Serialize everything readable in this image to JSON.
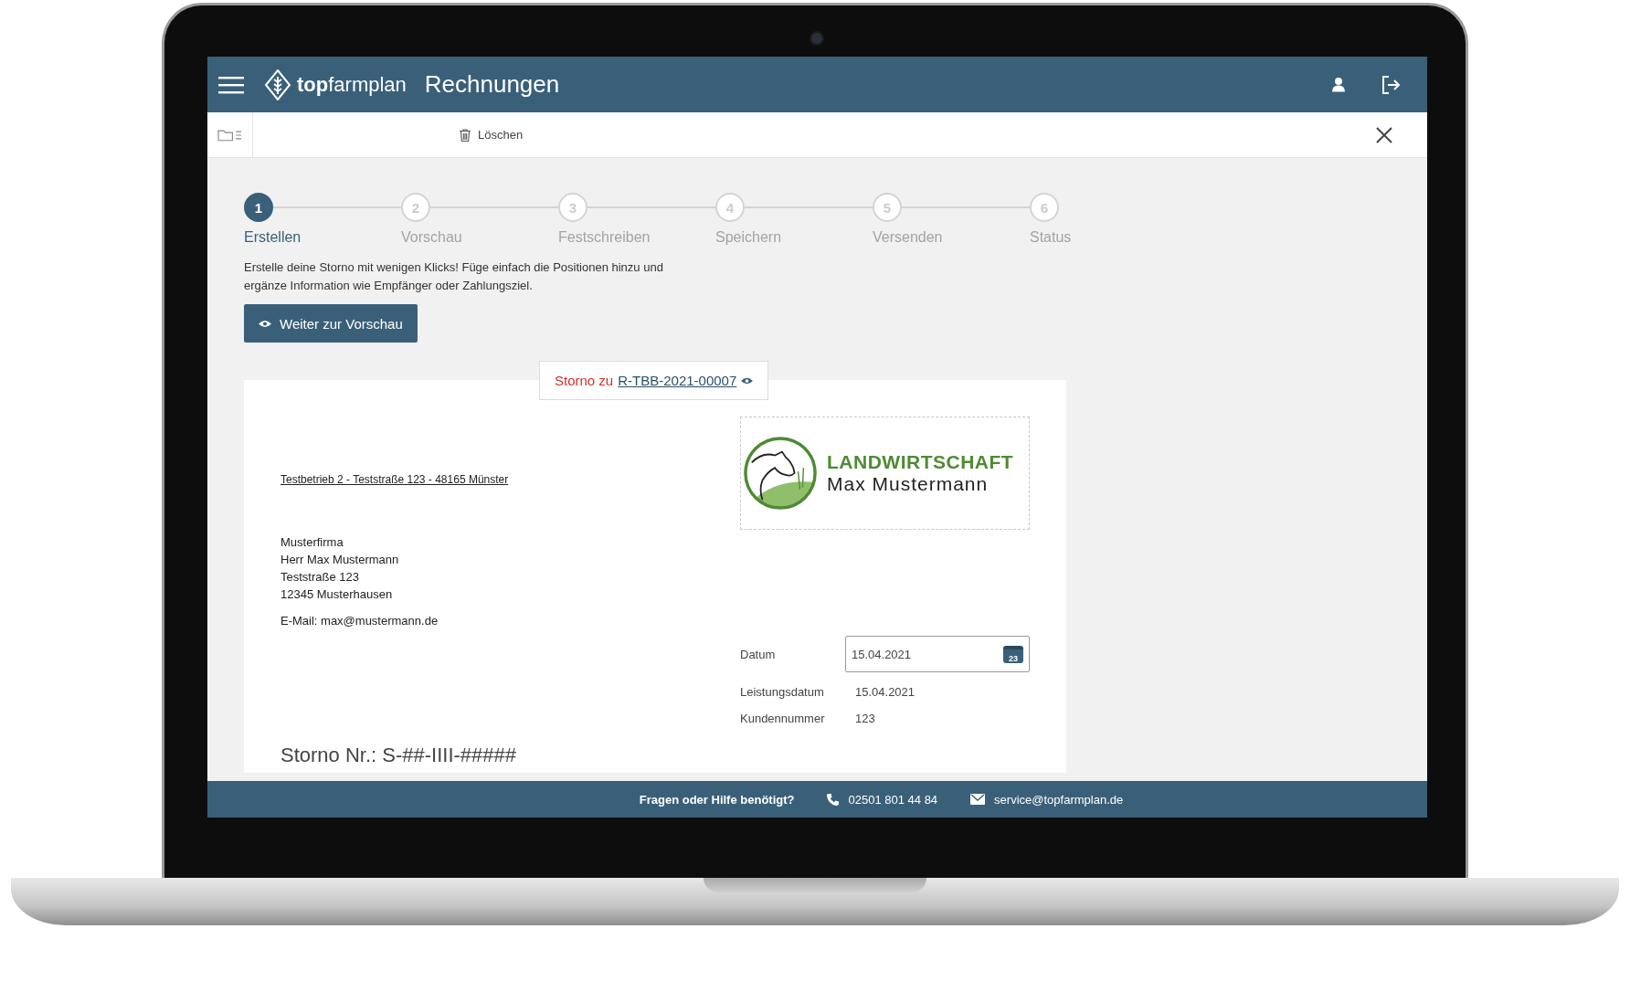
{
  "header": {
    "logo_text": "**top**farmplan",
    "title": "Rechnungen"
  },
  "toolbar": {
    "delete_label": "Löschen"
  },
  "stepper": {
    "steps": [
      {
        "number": "1",
        "label": "Erstellen",
        "selected": true
      },
      {
        "number": "2",
        "label": "Vorschau",
        "selected": false
      },
      {
        "number": "3",
        "label": "Festschreiben",
        "selected": false
      },
      {
        "number": "4",
        "label": "Speichern",
        "selected": false
      },
      {
        "number": "5",
        "label": "Versenden",
        "selected": false
      },
      {
        "number": "6",
        "label": "Status",
        "selected": false
      }
    ]
  },
  "intro": "Erstelle deine Storno mit wenigen Klicks! Füge einfach die Positionen hinzu und ergänze Information wie Empfänger oder Zahlungsziel.",
  "primary_button": "Weiter zur Vorschau",
  "document": {
    "tab": {
      "prefix": "Storno zu",
      "link": "R-TBB-2021-00007"
    },
    "sender_line": "Testbetrieb 2 - Teststraße 123 - 48165 Münster",
    "recipient_lines": [
      "Musterfirma",
      "Herr Max Mustermann",
      "Teststraße 123",
      "12345 Musterhausen"
    ],
    "email": "E-Mail: max@mustermann.de",
    "logo": {
      "line_1": "LANDWIRTSCHAFT",
      "line_2": "Max Mustermann"
    },
    "date_field": {
      "label": "Datum",
      "value": "15.04.2021",
      "calendar_day": "23"
    },
    "details": [
      {
        "label": "Leistungsdatum",
        "value": "15.04.2021"
      },
      {
        "label": "Kundennummer",
        "value": "123"
      }
    ],
    "heading": "Storno Nr.: S-##-IIII-#####"
  },
  "footer": {
    "question": "Fragen oder Hilfe benötigt?",
    "phone": "02501 801 44 84",
    "email": "service@topfarmplan.de"
  }
}
